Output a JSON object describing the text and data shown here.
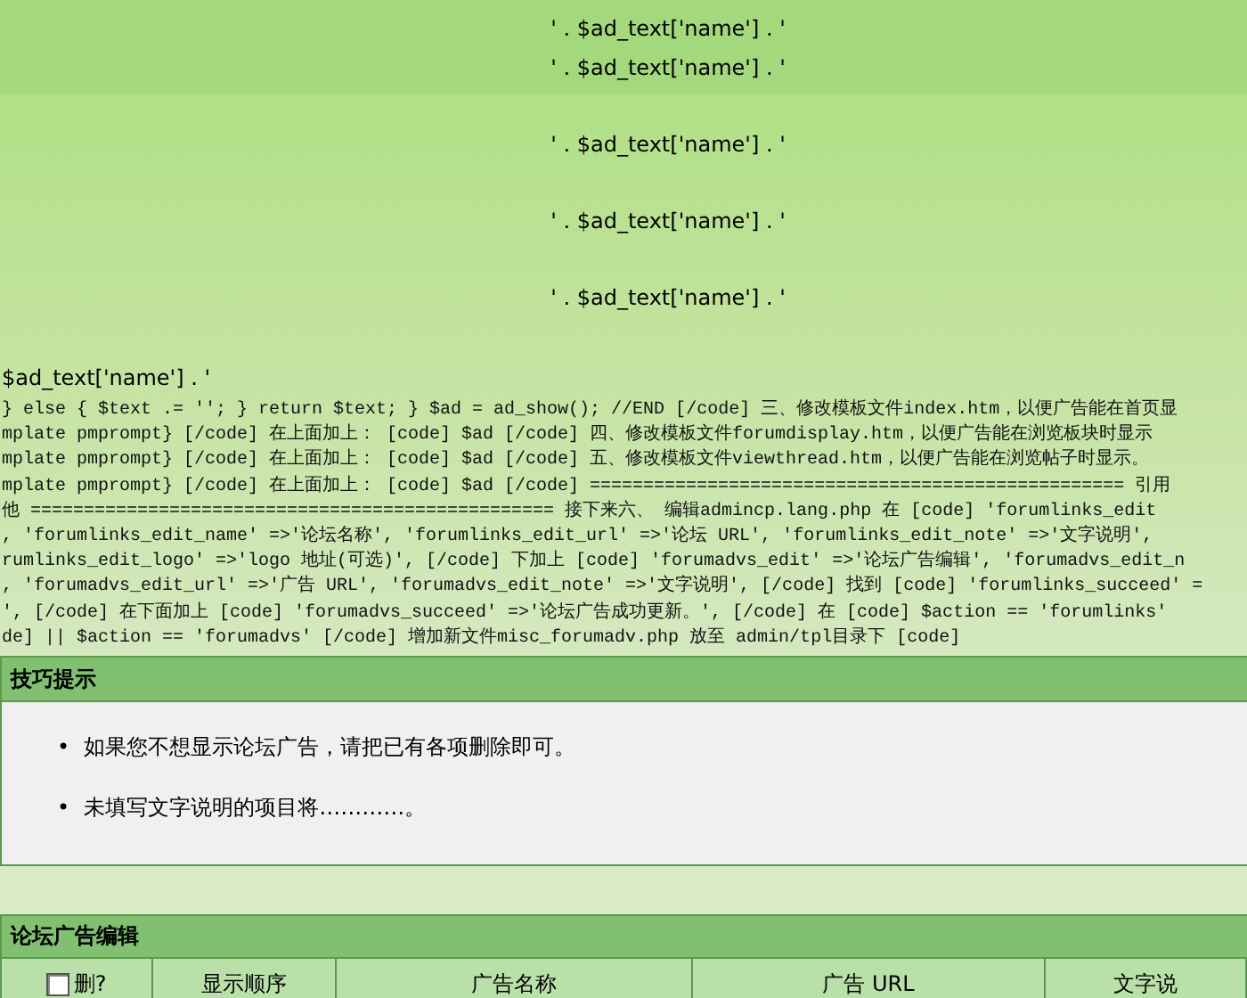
{
  "ad_lines": [
    "' . $ad_text['name'] . '",
    "' . $ad_text['name'] . '",
    "' . $ad_text['name'] . '",
    "' . $ad_text['name'] . '",
    "' . $ad_text['name'] . '"
  ],
  "ad_tail": "$ad_text['name'] . '",
  "code_lines": [
    "} else { $text .= ''; } return $text; } $ad = ad_show(); //END [/code] 三、修改模板文件index.htm，以便广告能在首页显",
    "mplate pmprompt} [/code] 在上面加上： [code] $ad [/code] 四、修改模板文件forumdisplay.htm，以便广告能在浏览板块时显示",
    "mplate pmprompt} [/code] 在上面加上： [code] $ad [/code] 五、修改模板文件viewthread.htm，以便广告能在浏览帖子时显示。",
    "mplate pmprompt} [/code] 在上面加上： [code] $ad [/code] ================================================== 引用",
    "他 ================================================= 接下来六、 编辑admincp.lang.php 在 [code] 'forumlinks_edit",
    ", 'forumlinks_edit_name' =>'论坛名称', 'forumlinks_edit_url' =>'论坛 URL', 'forumlinks_edit_note' =>'文字说明',",
    "rumlinks_edit_logo' =>'logo 地址(可选)', [/code] 下加上 [code] 'forumadvs_edit' =>'论坛广告编辑', 'forumadvs_edit_n",
    ", 'forumadvs_edit_url' =>'广告 URL', 'forumadvs_edit_note' =>'文字说明', [/code] 找到 [code] 'forumlinks_succeed' =",
    "', [/code] 在下面加上 [code] 'forumadvs_succeed' =>'论坛广告成功更新。', [/code] 在 [code] $action == 'forumlinks'",
    "de] || $action == 'forumadvs' [/code] 增加新文件misc_forumadv.php 放至 admin/tpl目录下 [code]"
  ],
  "tips": {
    "title": "技巧提示",
    "items": [
      {
        "bullet": "•",
        "text": "如果您不想显示论坛广告，请把已有各项删除即可。"
      },
      {
        "bullet": "•",
        "text": "未填写文字说明的项目将…………。"
      }
    ]
  },
  "ad_table": {
    "title": "论坛广告编辑",
    "select_all": {
      "label": "删?",
      "checked": false
    },
    "columns": [
      "显示顺序",
      "广告名称",
      "广告 URL",
      "文字说"
    ]
  }
}
